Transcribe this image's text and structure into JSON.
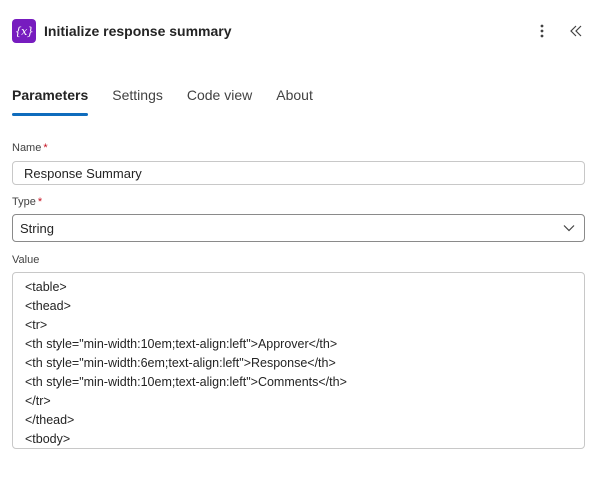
{
  "header": {
    "icon": "variable-icon",
    "icon_glyph": "{x}",
    "title": "Initialize response summary"
  },
  "tabs": [
    {
      "label": "Parameters",
      "active": true
    },
    {
      "label": "Settings",
      "active": false
    },
    {
      "label": "Code view",
      "active": false
    },
    {
      "label": "About",
      "active": false
    }
  ],
  "fields": {
    "name": {
      "label": "Name",
      "required": "*",
      "value": "Response Summary"
    },
    "type": {
      "label": "Type",
      "required": "*",
      "value": "String"
    },
    "value": {
      "label": "Value",
      "lines": [
        "<table>",
        "<thead>",
        "<tr>",
        "<th style=\"min-width:10em;text-align:left\">Approver</th>",
        "<th style=\"min-width:6em;text-align:left\">Response</th>",
        "<th style=\"min-width:10em;text-align:left\">Comments</th>",
        "</tr>",
        "</thead>",
        "<tbody>"
      ]
    }
  },
  "colors": {
    "icon_bg": "#771cbf",
    "tab_indicator": "#0f6cbd",
    "required": "#c50f1f"
  }
}
